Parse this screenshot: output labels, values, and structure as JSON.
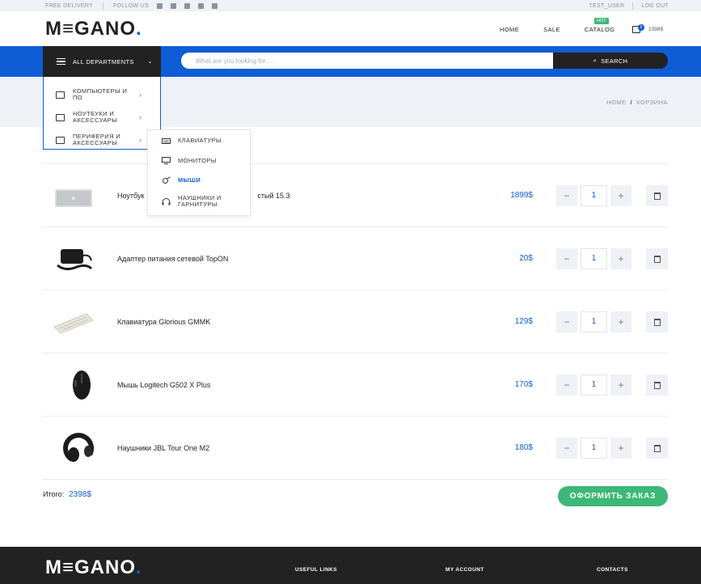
{
  "topbar": {
    "free_delivery": "FREE DELIVERY",
    "follow_us": "FOLLOW US",
    "user": "TEST_USER",
    "logout": "LOG OUT"
  },
  "header": {
    "logo_main": "M",
    "logo_e": "≡",
    "logo_rest": "GANO",
    "logo_dot": ".",
    "nav": [
      "HOME",
      "SALE",
      "CATALOG"
    ],
    "hot_badge": "HOT",
    "cart_count": "5",
    "cart_total": "2398$"
  },
  "search": {
    "departments_label": "ALL DEPARTMENTS",
    "placeholder": "What are you looking for ...",
    "button_label": "SEARCH"
  },
  "breadcrumb": {
    "home": "HOME",
    "separator": "/",
    "current": "КОРЗИНА"
  },
  "departments_menu": [
    {
      "label": "КОМПЬЮТЕРЫ И ПО"
    },
    {
      "label": "НОУТБУКИ И АКСЕССУАРЫ"
    },
    {
      "label": "ПЕРИФЕРИЯ И АКСЕССУАРЫ"
    }
  ],
  "submenu": [
    {
      "label": "КЛАВИАТУРЫ",
      "icon": "keyboard-icon"
    },
    {
      "label": "МОНИТОРЫ",
      "icon": "monitor-icon"
    },
    {
      "label": "МЫШИ",
      "icon": "mouse-icon",
      "active": true
    },
    {
      "label": "НАУШНИКИ И ГАРНИТУРЫ",
      "icon": "headphones-icon"
    }
  ],
  "cart_items": [
    {
      "name": "Ноутбук ... стый 15.3",
      "name_visible_left": "Ноутбук",
      "name_visible_right": "стый 15.3",
      "price": "1899$",
      "qty": "1",
      "thumb": "laptop"
    },
    {
      "name": "Адаптер питания сетевой TopON",
      "price": "20$",
      "qty": "1",
      "thumb": "adapter"
    },
    {
      "name": "Клавиатура Glorious GMMK",
      "price": "129$",
      "qty": "1",
      "thumb": "keyboard"
    },
    {
      "name": "Мышь Logitech G502 X Plus",
      "price": "170$",
      "qty": "1",
      "thumb": "mouse"
    },
    {
      "name": "Наушники JBL Tour One M2",
      "price": "180$",
      "qty": "1",
      "thumb": "headphones"
    }
  ],
  "qty_controls": {
    "minus": "−",
    "plus": "+"
  },
  "total": {
    "label": "Итого:",
    "value": "2398$"
  },
  "order_button": "ОФОРМИТЬ ЗАКАЗ",
  "footer": {
    "useful_links": "USEFUL LINKS",
    "my_account": "MY ACCOUNT",
    "contacts": "CONTACTS"
  },
  "colors": {
    "accent": "#0f5dd6",
    "green": "#3cb878",
    "dark": "#222222",
    "band": "#eef1f5"
  }
}
